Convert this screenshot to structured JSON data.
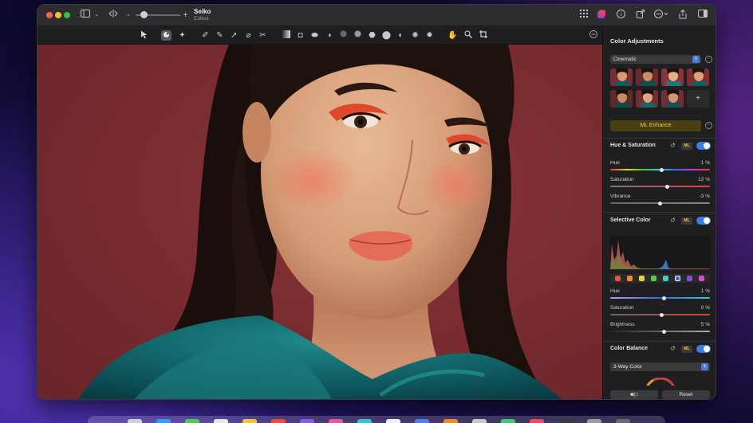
{
  "window": {
    "title": "Seiko",
    "subtitle": "Edited"
  },
  "titlebar_icons": [
    "sidebar-icon",
    "chevron-down-icon",
    "compare-icon",
    "zoom-out-icon",
    "zoom-in-icon",
    "grid-icon",
    "extensions-icon",
    "info-icon",
    "share-export-icon",
    "more-icon",
    "share-icon",
    "inspector-icon"
  ],
  "panel": {
    "title": "Color Adjustments",
    "preset_dropdown": "Cinematic",
    "add_label": "+",
    "ml_enhance_label": "ML Enhance",
    "footer_left_label": "■|□",
    "footer_reset_label": "Reset"
  },
  "sections": {
    "hue_saturation": {
      "title": "Hue & Saturation",
      "ml_label": "ML",
      "sliders": [
        {
          "label": "Hue",
          "value": "1 %"
        },
        {
          "label": "Saturation",
          "value": "12 %"
        },
        {
          "label": "Vibrance",
          "value": "-3 %"
        }
      ]
    },
    "selective_color": {
      "title": "Selective Color",
      "ml_label": "ML",
      "sliders": [
        {
          "label": "Hue",
          "value": "1 %"
        },
        {
          "label": "Saturation",
          "value": "0 %"
        },
        {
          "label": "Brightness",
          "value": "5 %"
        }
      ]
    },
    "color_balance": {
      "title": "Color Balance",
      "ml_label": "ML",
      "mode_dropdown": "3-Way Color"
    }
  },
  "colors": {
    "accent": "#3b7ce6",
    "ml_gold": "#f0c947",
    "backdrop": "#7a2e32"
  }
}
